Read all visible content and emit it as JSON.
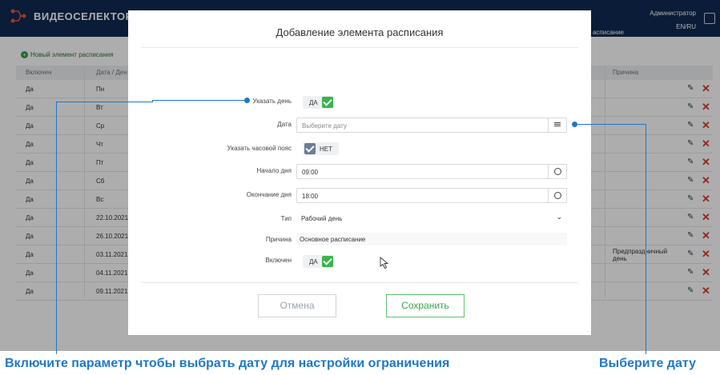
{
  "app": {
    "logo_text": "ВИДЕОСЕЛЕКТОР",
    "user_name": "Администратор",
    "language": "EN/RU",
    "nav_tab": "асписание"
  },
  "schedule": {
    "new_item_label": "Новый элемент расписания",
    "columns": [
      "Включен",
      "Дата / Ден",
      "Причина"
    ],
    "rows": [
      {
        "enabled": "Да",
        "day": "Пн",
        "reason": ""
      },
      {
        "enabled": "Да",
        "day": "Вт",
        "reason": ""
      },
      {
        "enabled": "Да",
        "day": "Ср",
        "reason": ""
      },
      {
        "enabled": "Да",
        "day": "Чт",
        "reason": ""
      },
      {
        "enabled": "Да",
        "day": "Пт",
        "reason": ""
      },
      {
        "enabled": "Да",
        "day": "Сб",
        "reason": ""
      },
      {
        "enabled": "Да",
        "day": "Вс",
        "reason": ""
      },
      {
        "enabled": "Да",
        "day": "22.10.2021",
        "reason": ""
      },
      {
        "enabled": "Да",
        "day": "26.10.2021",
        "reason": ""
      },
      {
        "enabled": "Да",
        "day": "03.11.2021",
        "reason": "Предпраздничный день"
      },
      {
        "enabled": "Да",
        "day": "04.11.2021",
        "reason": ""
      },
      {
        "enabled": "Да",
        "day": "09.11.2021",
        "reason": ""
      }
    ]
  },
  "modal": {
    "title": "Добавление элемента расписания",
    "specify_day": {
      "label": "Указать день",
      "value": "ДА"
    },
    "date": {
      "label": "Дата",
      "placeholder": "Выберите дату"
    },
    "specify_tz": {
      "label": "Указать часовой пояс",
      "value": "НЕТ"
    },
    "day_start": {
      "label": "Начало дня",
      "value": "09:00"
    },
    "day_end": {
      "label": "Окончание дня",
      "value": "18:00"
    },
    "type": {
      "label": "Тип",
      "value": "Рабочий день"
    },
    "reason": {
      "label": "Причина",
      "value": "Основное расписание"
    },
    "enabled": {
      "label": "Включен",
      "value": "ДА"
    },
    "cancel_label": "Отмена",
    "save_label": "Сохранить"
  },
  "annotations": {
    "left_caption": "Включите параметр чтобы выбрать дату для настройки ограничения",
    "right_caption": "Выберите дату"
  },
  "colors": {
    "annotation": "#1e78c8",
    "accent_green": "#39b54a",
    "header": "#0f2a52"
  }
}
